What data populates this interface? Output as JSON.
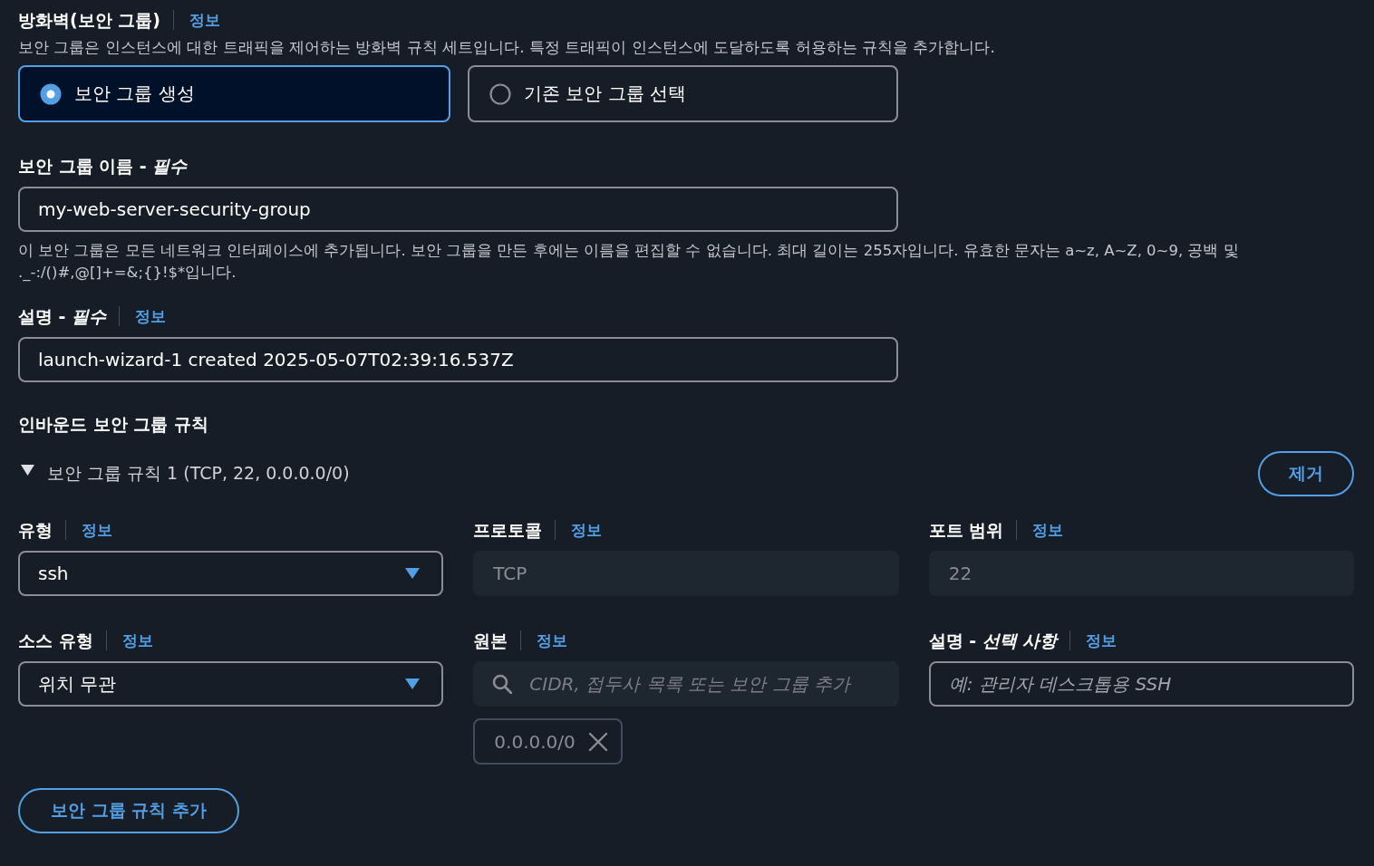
{
  "firewall": {
    "title": "방화벽(보안 그룹)",
    "info_link": "정보",
    "description": "보안 그룹은 인스턴스에 대한 트래픽을 제어하는 방화벽 규칙 세트입니다. 특정 트래픽이 인스턴스에 도달하도록 허용하는 규칙을 추가합니다.",
    "options": [
      {
        "label": "보안 그룹 생성",
        "selected": true
      },
      {
        "label": "기존 보안 그룹 선택",
        "selected": false
      }
    ],
    "name_field": {
      "label": "보안 그룹 이름 - *필수*",
      "value": "my-web-server-security-group",
      "help": "이 보안 그룹은 모든 네트워크 인터페이스에 추가됩니다. 보안 그룹을 만든 후에는 이름을 편집할 수 없습니다. 최대 길이는 255자입니다. 유효한 문자는 a~z, A~Z, 0~9, 공백 및 ._-:/()#,@[]+=&;{}!$*입니다."
    },
    "description_field": {
      "label": "설명 - *필수*",
      "info_link": "정보",
      "value": "launch-wizard-1 created 2025-05-07T02:39:16.537Z"
    },
    "inbound_rules": {
      "title": "인바운드 보안 그룹 규칙",
      "rules": [
        {
          "summary": "보안 그룹 규칙 1 (TCP, 22, 0.0.0.0/0)",
          "expanded": true,
          "remove_button": "제거",
          "fields": [
            {
              "kind": "select",
              "label": "유형",
              "info_link": "정보",
              "value": "ssh",
              "disabled": false
            },
            {
              "kind": "text",
              "label": "프로토콜",
              "info_link": "정보",
              "value": "TCP",
              "disabled": true
            },
            {
              "kind": "text",
              "label": "포트 범위",
              "info_link": "정보",
              "value": "22",
              "disabled": true
            },
            {
              "kind": "select",
              "label": "소스 유형",
              "info_link": "정보",
              "value": "위치 무관",
              "disabled": false
            },
            {
              "kind": "search",
              "label": "원본",
              "info_link": "정보",
              "placeholder": "CIDR, 접두사 목록 또는 보안 그룹 추가",
              "disabled": true,
              "tokens": [
                {
                  "label": "0.0.0.0/0",
                  "disabled": true
                }
              ]
            },
            {
              "kind": "text",
              "label": "설명 - *선택 사항*",
              "info_link": "정보",
              "placeholder": "예: 관리자 데스크톱용 SSH",
              "disabled": false
            }
          ]
        }
      ],
      "add_button": "보안 그룹 규칙 추가"
    }
  }
}
